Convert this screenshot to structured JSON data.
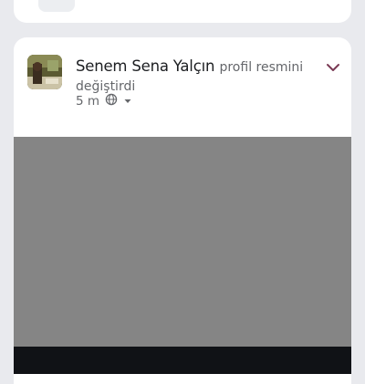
{
  "top_nav": {
    "icons": [
      "home-icon",
      "video-icon",
      "groups-icon",
      "add-icon",
      "profile-icon"
    ]
  },
  "post": {
    "author": "Senem Sena Yalçın",
    "action": "profil resmini değiştirdi",
    "time": "5 m",
    "privacy_icon": "globe-icon",
    "menu_icon": "chevron-down-icon",
    "colors": {
      "accent": "#e41e3f",
      "photo_placeholder": "#858585"
    }
  }
}
